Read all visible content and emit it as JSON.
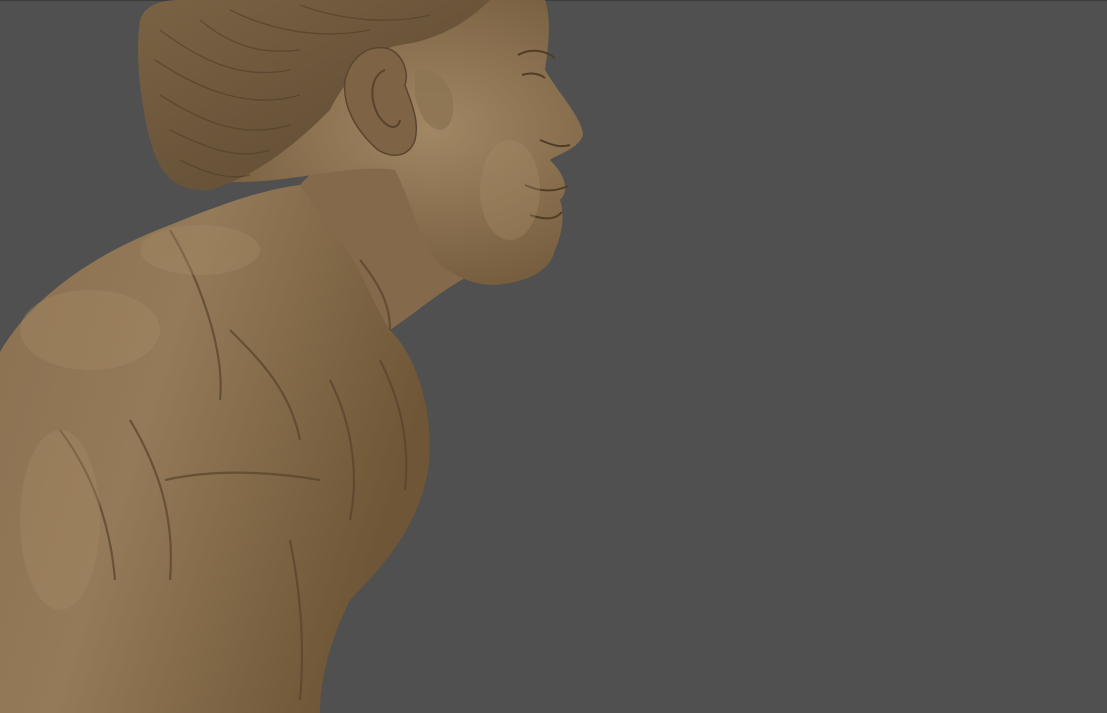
{
  "viewport": {
    "background_color": "#505050",
    "model_material_color": "#8c7352",
    "model_shadow_color": "#5a4630",
    "model_highlight_color": "#a88d68"
  },
  "model": {
    "icons": [
      "sculpt-bust-model"
    ]
  }
}
